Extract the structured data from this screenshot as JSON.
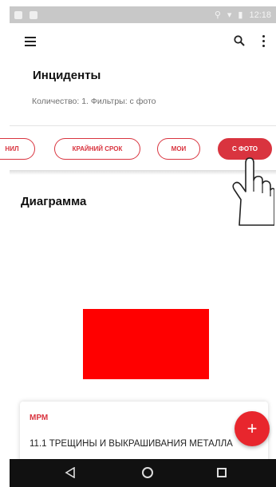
{
  "status_bar": {
    "time": "12:18"
  },
  "toolbar": {
    "menu_icon": "hamburger-menu-icon",
    "search_icon": "search-icon",
    "more_icon": "more-vertical-icon"
  },
  "page": {
    "title": "Инциденты",
    "subtitle": "Количество: 1. Фильтры: с фото"
  },
  "filters": [
    {
      "label": "нил",
      "active": false
    },
    {
      "label": "крайний срок",
      "active": false
    },
    {
      "label": "мои",
      "active": false
    },
    {
      "label": "с фото",
      "active": true
    }
  ],
  "section": {
    "title": "Диаграмма"
  },
  "chart": {
    "color": "#ff0000"
  },
  "card": {
    "tag": "МРМ",
    "description": "11.1 ТРЕЩИНЫ И ВЫКРАШИВАНИЯ МЕТАЛЛА"
  },
  "fab": {
    "label": "+"
  },
  "colors": {
    "accent": "#d9343f",
    "fab": "#e8262d"
  }
}
